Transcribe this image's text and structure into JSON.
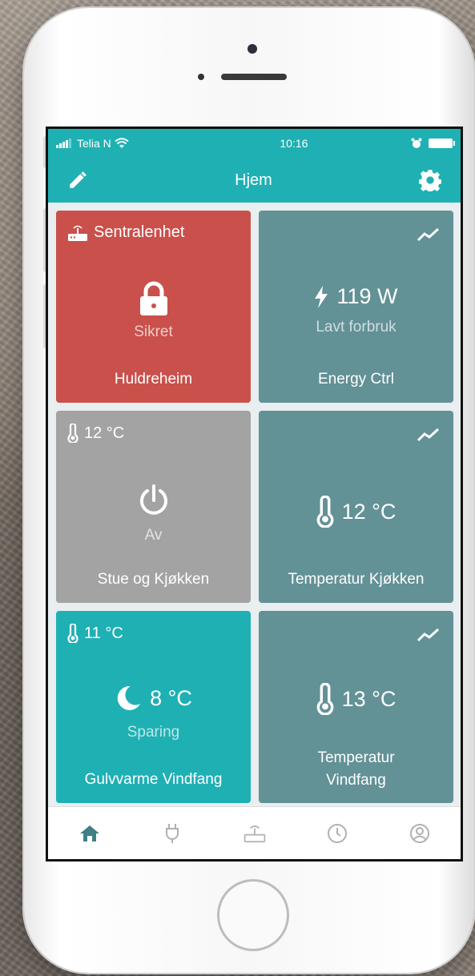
{
  "status_bar": {
    "carrier": "Telia N",
    "time": "10:16"
  },
  "nav": {
    "title": "Hjem",
    "edit_icon": "pencil-icon",
    "settings_icon": "gear-icon"
  },
  "colors": {
    "teal": "#1fb0b4",
    "red": "#c9504b",
    "grey": "#a3a3a3",
    "slate": "#629196"
  },
  "tiles": [
    {
      "badge": "Sentralenhet",
      "badge_icon": "router-icon",
      "status": "Sikret",
      "state_icon": "lock-icon",
      "name": "Huldreheim",
      "color": "#c9504b"
    },
    {
      "value": "119 W",
      "value_icon": "bolt-icon",
      "status": "Lavt forbruk",
      "name": "Energy Ctrl",
      "chart_icon": "trend-icon",
      "color": "#629196"
    },
    {
      "badge": "12 °C",
      "badge_icon": "thermometer-icon",
      "status": "Av",
      "state_icon": "power-icon",
      "name": "Stue og Kjøkken",
      "color": "#a3a3a3"
    },
    {
      "value": "12 °C",
      "value_icon": "thermometer-icon",
      "name": "Temperatur Kjøkken",
      "chart_icon": "trend-icon",
      "color": "#629196"
    },
    {
      "badge": "11 °C",
      "badge_icon": "thermometer-icon",
      "value": "8 °C",
      "value_icon": "moon-icon",
      "status": "Sparing",
      "name": "Gulvvarme Vindfang",
      "color": "#1fb0b4"
    },
    {
      "value": "13 °C",
      "value_icon": "thermometer-icon",
      "name_line1": "Temperatur",
      "name_line2": "Vindfang",
      "chart_icon": "trend-icon",
      "color": "#629196"
    }
  ],
  "tab_bar": [
    "home-icon",
    "plug-icon",
    "router-icon",
    "clock-icon",
    "user-icon"
  ]
}
